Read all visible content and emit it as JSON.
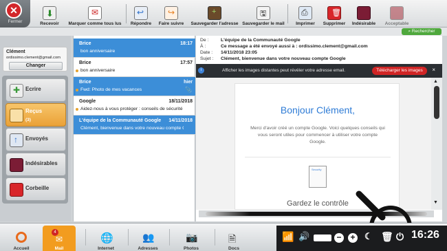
{
  "toolbar": {
    "close_label": "Fermer",
    "buttons": [
      {
        "label": "Recevoir",
        "icon": "receive-icon"
      },
      {
        "label": "Marquer comme tous lus",
        "icon": "mark-read-icon"
      },
      {
        "label": "Répondre",
        "icon": "reply-icon"
      },
      {
        "label": "Faire suivre",
        "icon": "forward-icon"
      },
      {
        "label": "Sauvegarder l'adresse",
        "icon": "save-address-icon"
      },
      {
        "label": "Sauvegarder le mail",
        "icon": "save-mail-icon"
      },
      {
        "label": "Imprimer",
        "icon": "printer-icon"
      },
      {
        "label": "Supprimer",
        "icon": "trash-icon"
      },
      {
        "label": "Indésirable",
        "icon": "spam-icon"
      },
      {
        "label": "Acceptable",
        "icon": "acceptable-icon"
      }
    ]
  },
  "search": {
    "label": "Rechercher"
  },
  "account": {
    "name": "Clément",
    "email": "ordissimo.clement@gmail.com",
    "change_label": "Changer"
  },
  "nav": [
    {
      "label": "Ecrire",
      "count": "",
      "icon": "write-icon"
    },
    {
      "label": "Reçus",
      "count": "(3)",
      "icon": "inbox-icon"
    },
    {
      "label": "Envoyés",
      "count": "",
      "icon": "sent-icon"
    },
    {
      "label": "Indésirables",
      "count": "",
      "icon": "spam-folder-icon"
    },
    {
      "label": "Corbeille",
      "count": "",
      "icon": "trash-folder-icon"
    }
  ],
  "messages": [
    {
      "from": "Brice",
      "date": "18:17",
      "subject": "bon anniversaire",
      "selected": true,
      "unread": false,
      "attachment": false
    },
    {
      "from": "Brice",
      "date": "17:57",
      "subject": "bon anniversaire",
      "selected": false,
      "unread": true,
      "attachment": false
    },
    {
      "from": "Brice",
      "date": "hier",
      "subject": "Fwd: Photo de mes vacances",
      "selected": true,
      "unread": true,
      "attachment": true
    },
    {
      "from": "Google",
      "date": "18/11/2018",
      "subject": "Aidez-nous à vous protéger : conseils de sécurité ...",
      "selected": false,
      "unread": true,
      "attachment": false
    },
    {
      "from": "L'équipe de la Communauté Google",
      "date": "14/11/2018",
      "subject": "Clément, bienvenue dans votre nouveau compte G...",
      "selected": true,
      "unread": false,
      "attachment": false
    }
  ],
  "header": {
    "de_label": "De :",
    "de": "L'équipe de la Communauté Google",
    "a_label": "À :",
    "a": "Ce message a été envoyé aussi à : ordissimo.clement@gmail.com",
    "date_label": "Date :",
    "date": "14/11/2018 23:05",
    "sujet_label": "Sujet :",
    "sujet": "Clément, bienvenue dans votre nouveau compte Google"
  },
  "images_bar": {
    "text": "Afficher les images distantes peut révéler votre adresse email.",
    "button": "Télécharger les images",
    "close": "×"
  },
  "email": {
    "greeting": "Bonjour Clément,",
    "intro": "Merci d'avoir créé un compte Google. Voici quelques conseils qui vous seront utiles pour commencer à utiliser votre compte Google.",
    "image_caption": "Security",
    "section_title": "Gardez le contrôle"
  },
  "taskbar": [
    {
      "label": "Accueil",
      "icon": "home-icon",
      "active": false
    },
    {
      "label": "Mail",
      "icon": "mail-icon",
      "active": true,
      "badge": "4"
    },
    {
      "label": "Internet",
      "icon": "globe-icon",
      "active": false
    },
    {
      "label": "Adresses",
      "icon": "contacts-icon",
      "active": false
    },
    {
      "label": "Photos",
      "icon": "camera-icon",
      "active": false
    },
    {
      "label": "Docs",
      "icon": "docs-icon",
      "active": false
    }
  ],
  "clock": "16:26",
  "colors": {
    "accent": "#3c8ed8",
    "active_tab": "#f29c1f",
    "danger": "#d02525",
    "search": "#4fa83d"
  }
}
